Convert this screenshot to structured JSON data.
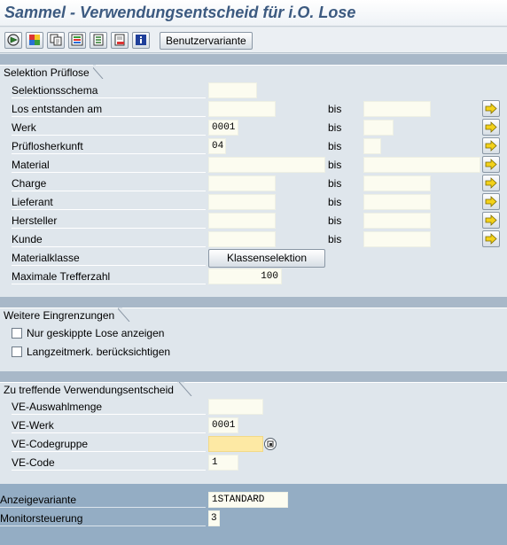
{
  "window": {
    "title": "Sammel - Verwendungsentscheid für i.O. Lose"
  },
  "toolbar": {
    "icons": [
      "execute-icon",
      "variant-icon",
      "copy-icon",
      "selection-options-icon",
      "multiple-selection-icon",
      "delete-icon",
      "info-icon"
    ],
    "variant_button": "Benutzervariante"
  },
  "selektion": {
    "title": "Selektion Prüflose",
    "bis": "bis",
    "rows": [
      {
        "label": "Selektionsschema",
        "from": "",
        "to": null
      },
      {
        "label": "Los entstanden am",
        "from": "",
        "to": ""
      },
      {
        "label": "Werk",
        "from": "0001",
        "to": ""
      },
      {
        "label": "Prüflosherkunft",
        "from": "04",
        "to": ""
      },
      {
        "label": "Material",
        "from": "",
        "to": ""
      },
      {
        "label": "Charge",
        "from": "",
        "to": ""
      },
      {
        "label": "Lieferant",
        "from": "",
        "to": ""
      },
      {
        "label": "Hersteller",
        "from": "",
        "to": ""
      },
      {
        "label": "Kunde",
        "from": "",
        "to": ""
      }
    ],
    "materialklasse_label": "Materialklasse",
    "klassenselektion_button": "Klassenselektion",
    "max_treffer_label": "Maximale Trefferzahl",
    "max_treffer_value": "100"
  },
  "eingrenzungen": {
    "title": "Weitere Eingrenzungen",
    "checkboxes": [
      {
        "label": "Nur geskippte Lose anzeigen",
        "checked": false
      },
      {
        "label": "Langzeitmerk. berücksichtigen",
        "checked": false
      }
    ]
  },
  "verwendung": {
    "title": "Zu treffende Verwendungsentscheid",
    "rows": [
      {
        "label": "VE-Auswahlmenge",
        "value": ""
      },
      {
        "label": "VE-Werk",
        "value": "0001"
      },
      {
        "label": "VE-Codegruppe",
        "value": ""
      },
      {
        "label": "VE-Code",
        "value": "1"
      }
    ]
  },
  "bottom": {
    "anzeigevariante_label": "Anzeigevariante",
    "anzeigevariante_value": "1STANDARD",
    "monitorsteuerung_label": "Monitorsteuerung",
    "monitorsteuerung_value": "3"
  }
}
